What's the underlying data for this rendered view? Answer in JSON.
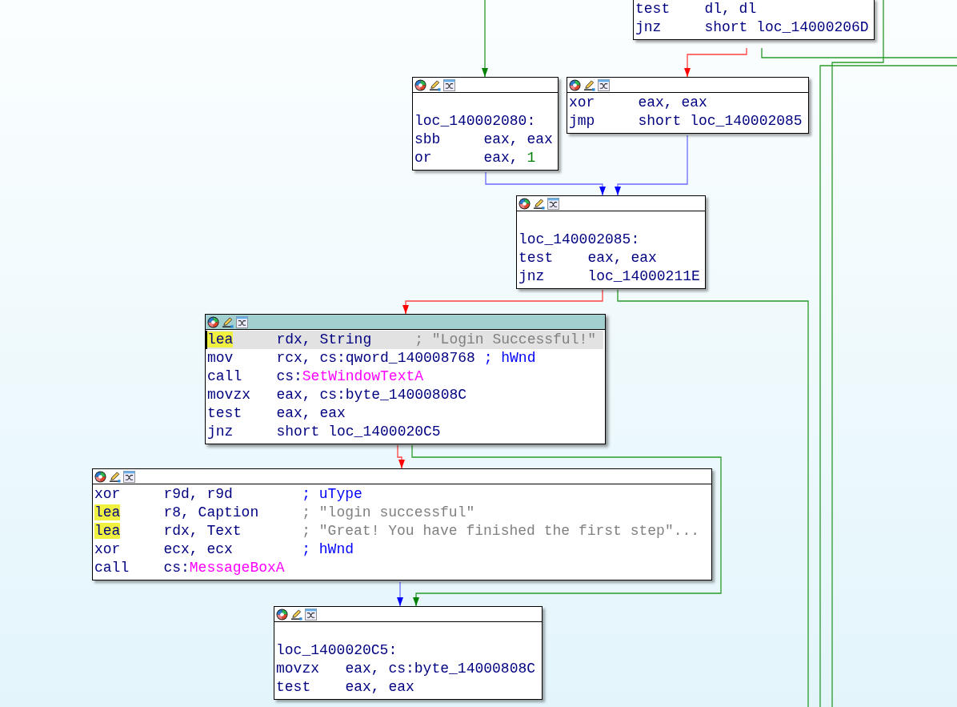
{
  "graph": {
    "nodes": [
      {
        "selected": false,
        "lines": [
          {
            "mnemonic": "test",
            "operands": [
              {
                "text": "dl, dl",
                "kind": "plain"
              }
            ],
            "highlighted": false,
            "selected": false
          },
          {
            "mnemonic": "jnz",
            "operands": [
              {
                "text": "short loc_14000206D",
                "kind": "plain"
              }
            ],
            "highlighted": false,
            "selected": false
          }
        ]
      },
      {
        "selected": false,
        "label": "loc_140002080:",
        "lines": [
          {
            "mnemonic": "sbb",
            "operands": [
              {
                "text": "eax, eax",
                "kind": "plain"
              }
            ],
            "highlighted": false,
            "selected": false
          },
          {
            "mnemonic": "or",
            "operands": [
              {
                "text": "eax, ",
                "kind": "plain"
              },
              {
                "text": "1",
                "kind": "number"
              }
            ],
            "highlighted": false,
            "selected": false
          }
        ]
      },
      {
        "selected": false,
        "lines": [
          {
            "mnemonic": "xor",
            "operands": [
              {
                "text": "eax, eax",
                "kind": "plain"
              }
            ],
            "highlighted": false,
            "selected": false
          },
          {
            "mnemonic": "jmp",
            "operands": [
              {
                "text": "short loc_140002085",
                "kind": "plain"
              }
            ],
            "highlighted": false,
            "selected": false
          }
        ]
      },
      {
        "selected": false,
        "label": "loc_140002085:",
        "lines": [
          {
            "mnemonic": "test",
            "operands": [
              {
                "text": "eax, eax",
                "kind": "plain"
              }
            ],
            "highlighted": false,
            "selected": false
          },
          {
            "mnemonic": "jnz",
            "operands": [
              {
                "text": "loc_14000211E",
                "kind": "plain"
              }
            ],
            "highlighted": false,
            "selected": false
          }
        ]
      },
      {
        "selected": true,
        "lines": [
          {
            "mnemonic": "lea",
            "operands": [
              {
                "text": "rdx, String",
                "kind": "plain"
              }
            ],
            "comment": {
              "text": "; \"Login Successful!\"",
              "kind": "string"
            },
            "highlighted": true,
            "selected": true
          },
          {
            "mnemonic": "mov",
            "operands": [
              {
                "text": "rcx, cs:qword_140008768",
                "kind": "plain"
              }
            ],
            "comment": {
              "text": "; hWnd",
              "kind": "symbol"
            },
            "highlighted": false,
            "selected": false
          },
          {
            "mnemonic": "call",
            "operands": [
              {
                "text": "cs:",
                "kind": "plain"
              },
              {
                "text": "SetWindowTextA",
                "kind": "import"
              }
            ],
            "highlighted": false,
            "selected": false
          },
          {
            "mnemonic": "movzx",
            "operands": [
              {
                "text": "eax, cs:byte_14000808C",
                "kind": "plain"
              }
            ],
            "highlighted": false,
            "selected": false
          },
          {
            "mnemonic": "test",
            "operands": [
              {
                "text": "eax, eax",
                "kind": "plain"
              }
            ],
            "highlighted": false,
            "selected": false
          },
          {
            "mnemonic": "jnz",
            "operands": [
              {
                "text": "short loc_1400020C5",
                "kind": "plain"
              }
            ],
            "highlighted": false,
            "selected": false
          }
        ]
      },
      {
        "selected": false,
        "lines": [
          {
            "mnemonic": "xor",
            "operands": [
              {
                "text": "r9d, r9d",
                "kind": "plain"
              }
            ],
            "comment": {
              "text": "; uType",
              "kind": "symbol"
            },
            "highlighted": false,
            "selected": false
          },
          {
            "mnemonic": "lea",
            "operands": [
              {
                "text": "r8, Caption",
                "kind": "plain"
              }
            ],
            "comment": {
              "text": "; \"login successful\"",
              "kind": "string"
            },
            "highlighted": true,
            "selected": false
          },
          {
            "mnemonic": "lea",
            "operands": [
              {
                "text": "rdx, Text",
                "kind": "plain"
              }
            ],
            "comment": {
              "text": "; \"Great! You have finished the first step\"...",
              "kind": "string"
            },
            "highlighted": true,
            "selected": false
          },
          {
            "mnemonic": "xor",
            "operands": [
              {
                "text": "ecx, ecx",
                "kind": "plain"
              }
            ],
            "comment": {
              "text": "; hWnd",
              "kind": "symbol"
            },
            "highlighted": false,
            "selected": false
          },
          {
            "mnemonic": "call",
            "operands": [
              {
                "text": "cs:",
                "kind": "plain"
              },
              {
                "text": "MessageBoxA",
                "kind": "import"
              }
            ],
            "highlighted": false,
            "selected": false
          }
        ]
      },
      {
        "selected": false,
        "label": "loc_1400020C5:",
        "lines": [
          {
            "mnemonic": "movzx",
            "operands": [
              {
                "text": "eax, cs:byte_14000808C",
                "kind": "plain"
              }
            ],
            "highlighted": false,
            "selected": false
          },
          {
            "mnemonic": "test",
            "operands": [
              {
                "text": "eax, eax",
                "kind": "plain"
              }
            ],
            "highlighted": false,
            "selected": false
          }
        ]
      }
    ],
    "edges": [
      {
        "kind": "taken"
      },
      {
        "kind": "fallthrough"
      },
      {
        "kind": "taken"
      },
      {
        "kind": "taken"
      },
      {
        "kind": "taken"
      },
      {
        "kind": "jump"
      },
      {
        "kind": "jump"
      },
      {
        "kind": "fallthrough"
      },
      {
        "kind": "taken"
      },
      {
        "kind": "fallthrough"
      },
      {
        "kind": "taken"
      },
      {
        "kind": "jump"
      }
    ]
  }
}
